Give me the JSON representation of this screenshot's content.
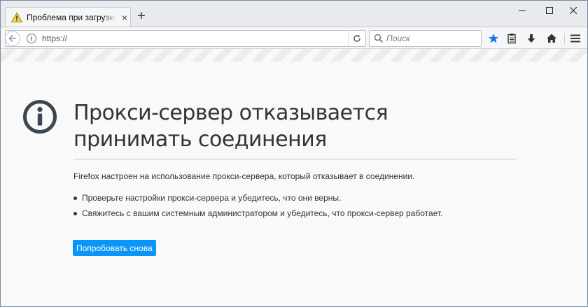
{
  "tab": {
    "title": "Проблема при загрузке стр",
    "icon": "warning-icon",
    "close": "×"
  },
  "window_controls": [
    "minimize-icon",
    "maximize-icon",
    "close-icon"
  ],
  "nav": {
    "url": "https://",
    "search_placeholder": "Поиск",
    "bookmark_star_color": "#1a73e8"
  },
  "error": {
    "icon": "info-icon",
    "title": "Прокси-сервер отказывается принимать соединения",
    "description": "Firefox настроен на использование прокси-сервера, который отказывает в соединении.",
    "bullets": [
      "Проверьте настройки прокси-сервера и убедитесь, что они верны.",
      "Свяжитесь с вашим системным администратором и убедитесь, что прокси-сервер работает."
    ],
    "button_label": "Попробовать снова",
    "button_color": "#0996f8"
  }
}
